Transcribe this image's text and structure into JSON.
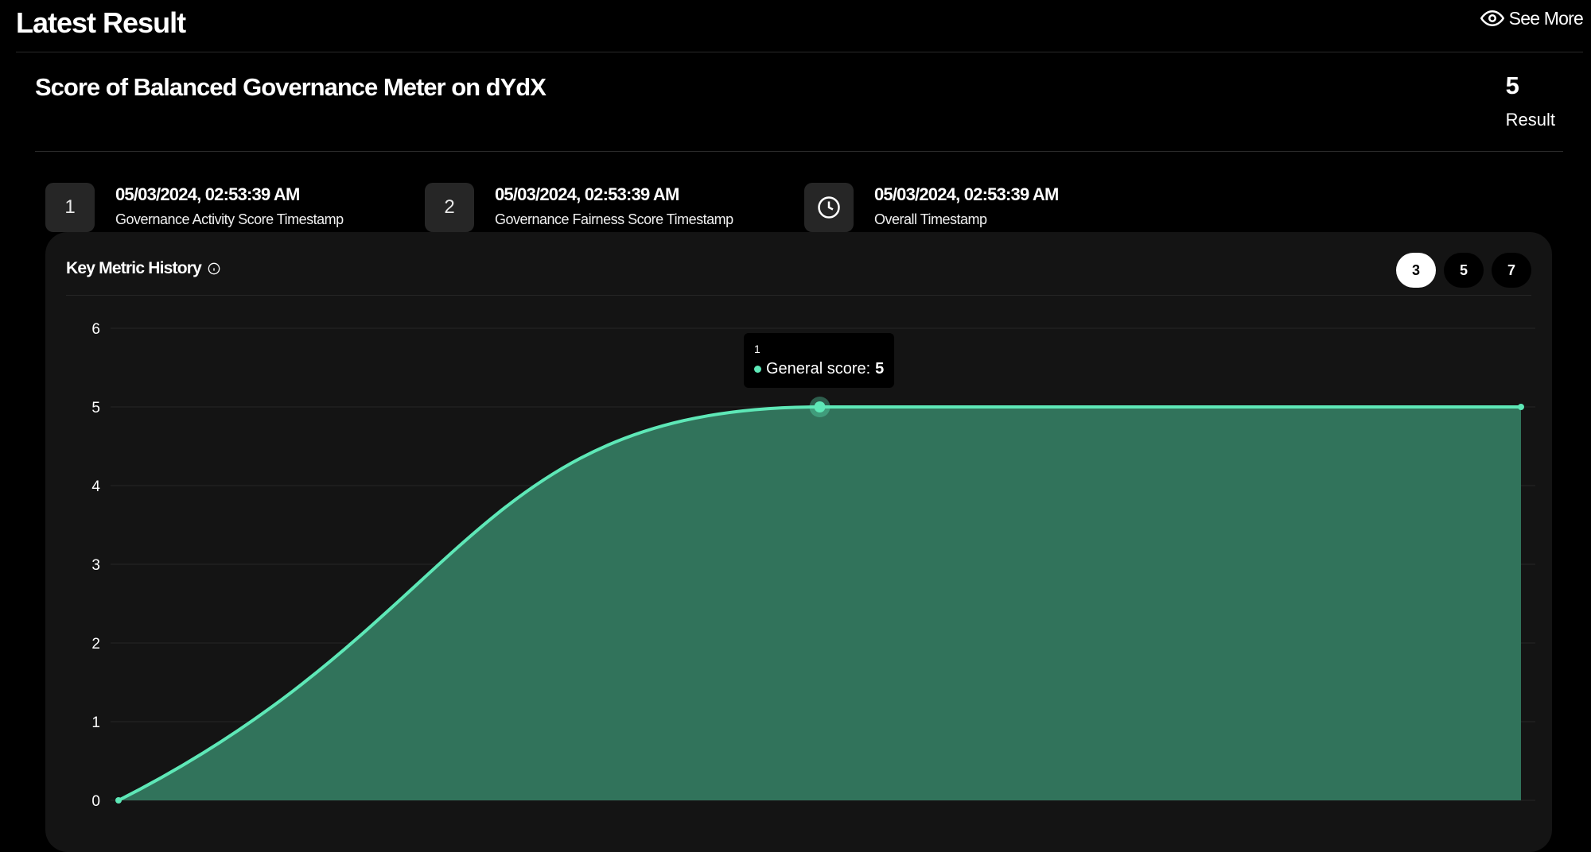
{
  "header": {
    "title": "Latest Result",
    "see_more_label": "See More"
  },
  "meter": {
    "title": "Score of Balanced Governance Meter on dYdX",
    "result_value": "5",
    "result_label": "Result"
  },
  "timestamps": [
    {
      "badge": "1",
      "value": "05/03/2024, 02:53:39 AM",
      "label": "Governance Activity Score Timestamp"
    },
    {
      "badge": "2",
      "value": "05/03/2024, 02:53:39 AM",
      "label": "Governance Fairness Score Timestamp"
    },
    {
      "badge_icon": "clock-icon",
      "value": "05/03/2024, 02:53:39 AM",
      "label": "Overall Timestamp"
    }
  ],
  "history": {
    "title": "Key Metric History",
    "ranges": [
      "3",
      "5",
      "7"
    ],
    "active_range": "3",
    "tooltip": {
      "title": "1",
      "series_label": "General score:",
      "value": "5"
    }
  },
  "colors": {
    "accent": "#5ee8b7",
    "area_fill": "#31735b",
    "background": "#000000",
    "card": "#141414"
  },
  "chart_data": {
    "type": "area",
    "x": [
      0,
      1,
      2
    ],
    "series": [
      {
        "name": "General score",
        "values": [
          0,
          5,
          5
        ]
      }
    ],
    "yticks": [
      0,
      1,
      2,
      3,
      4,
      5,
      6
    ],
    "ylim": [
      0,
      6
    ],
    "grid": true,
    "smooth": true
  }
}
